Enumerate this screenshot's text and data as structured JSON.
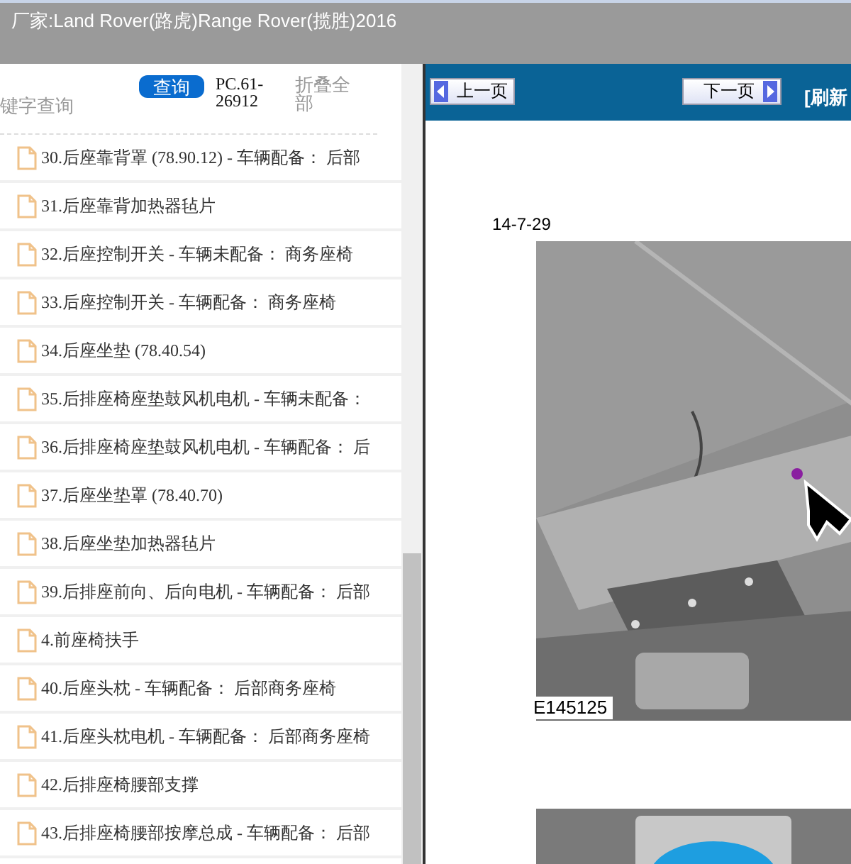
{
  "window": {
    "title": "厂家:Land Rover(路虎)Range Rover(揽胜)2016"
  },
  "sidebar": {
    "search": {
      "placeholder": "键字查询"
    },
    "search_button": "查询",
    "code": "PC.61-26912",
    "collapse": "折叠全部",
    "items": [
      {
        "label": "30.后座靠背罩 (78.90.12) - 车辆配备： 后部"
      },
      {
        "label": "31.后座靠背加热器毡片"
      },
      {
        "label": "32.后座控制开关 - 车辆未配备： 商务座椅"
      },
      {
        "label": "33.后座控制开关 - 车辆配备： 商务座椅"
      },
      {
        "label": "34.后座坐垫 (78.40.54)"
      },
      {
        "label": "35.后排座椅座垫鼓风机电机 - 车辆未配备："
      },
      {
        "label": "36.后排座椅座垫鼓风机电机 - 车辆配备： 后"
      },
      {
        "label": "37.后座坐垫罩 (78.40.70)"
      },
      {
        "label": "38.后座坐垫加热器毡片"
      },
      {
        "label": "39.后排座前向、后向电机 - 车辆配备： 后部"
      },
      {
        "label": "4.前座椅扶手"
      },
      {
        "label": "40.后座头枕 - 车辆配备： 后部商务座椅"
      },
      {
        "label": "41.后座头枕电机 - 车辆配备： 后部商务座椅"
      },
      {
        "label": "42.后排座椅腰部支撑"
      },
      {
        "label": "43.后排座椅腰部按摩总成 - 车辆配备： 后部"
      }
    ]
  },
  "viewer": {
    "prev_button": "上一页",
    "next_button": "下一页",
    "refresh": "[刷新",
    "date": "14-7-29",
    "figure_caption": "E145125"
  }
}
